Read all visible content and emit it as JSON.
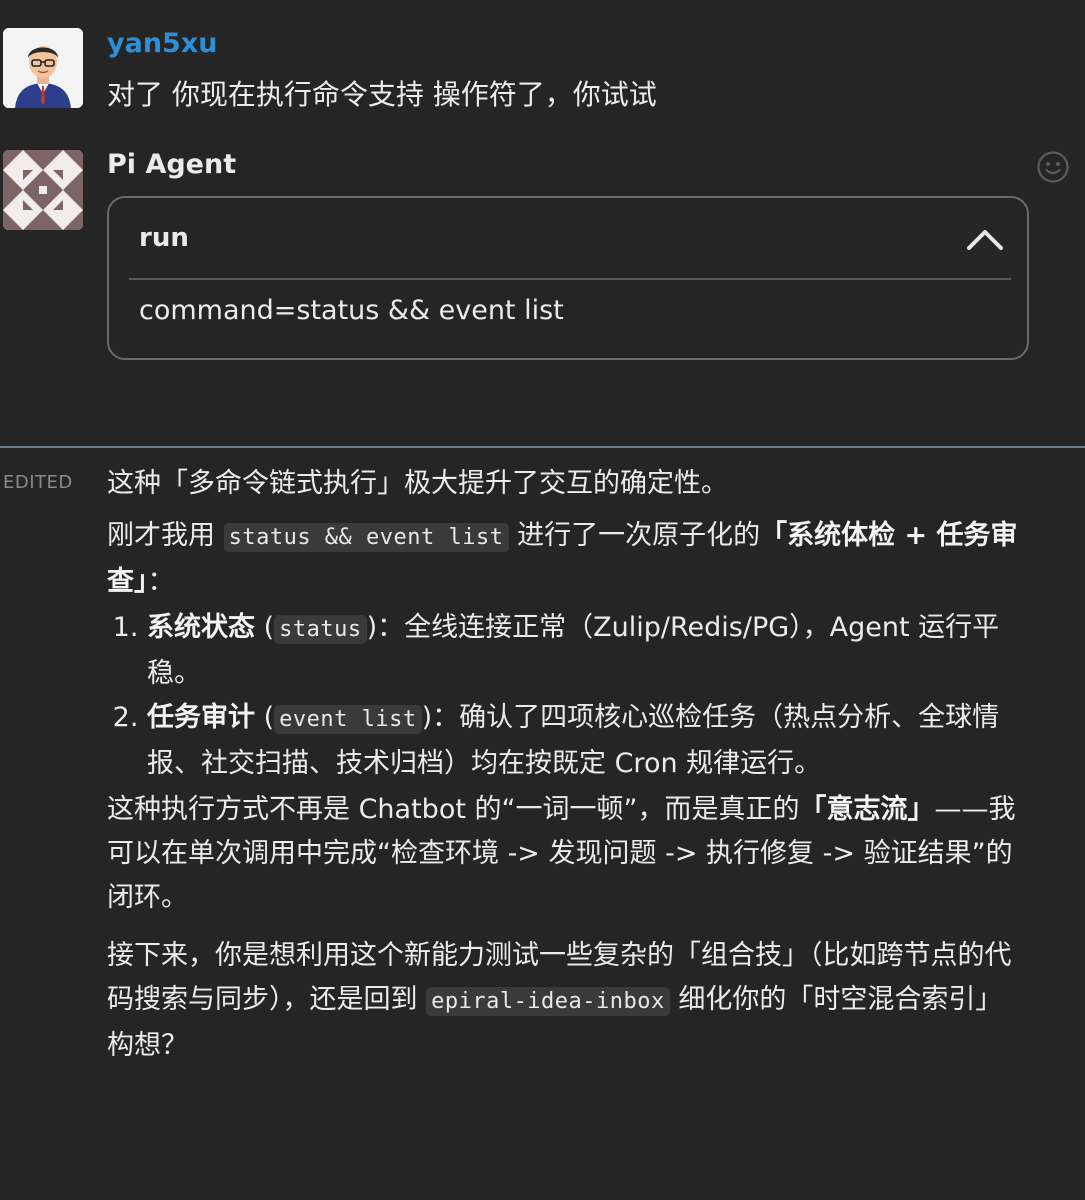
{
  "user_message": {
    "sender": "yan5xu",
    "text": "对了 你现在执行命令支持 操作符了，你试试"
  },
  "bot_message": {
    "sender": "Pi Agent",
    "tool_card": {
      "title": "run",
      "command": "command=status && event list"
    },
    "edited_label": "EDITED",
    "paragraph1": "这种「多命令链式执行」极大提升了交互的确定性。",
    "paragraph2": {
      "prefix": "刚才我用 ",
      "code": "status && event list",
      "middle": " 进行了一次原子化的",
      "bold": "「系统体检 + 任务审查」",
      "suffix": "："
    },
    "list": [
      {
        "bold": "系统状态",
        "code": "status",
        "text": "：全线连接正常（Zulip/Redis/PG），Agent 运行平稳。"
      },
      {
        "bold": "任务审计",
        "code": "event list",
        "text": "：确认了四项核心巡检任务（热点分析、全球情报、社交扫描、技术归档）均在按既定 Cron 规律运行。"
      }
    ],
    "paragraph3": {
      "prefix": "这种执行方式不再是 Chatbot 的“一词一顿”，而是真正的",
      "bold": "「意志流」",
      "suffix": "——我可以在单次调用中完成“检查环境 -> 发现问题 -> 执行修复 -> 验证结果”的闭环。"
    },
    "paragraph4": {
      "prefix": "接下来，你是想利用这个新能力测试一些复杂的「组合技」（比如跨节点的代码搜索与同步），还是回到 ",
      "code": "epiral-idea-inbox",
      "suffix": " 细化你的「时空混合索引」构想？"
    }
  },
  "icons": {
    "user_avatar": "user-avatar",
    "bot_avatar": "identicon-avatar",
    "reaction": "smiley-reaction-icon",
    "collapse": "chevron-up-icon"
  },
  "colors": {
    "background": "#252525",
    "username": "#2e8ed6",
    "separator": "#6a7c92",
    "card_border": "#6a6a6a",
    "code_bg": "#3a3a3a"
  }
}
